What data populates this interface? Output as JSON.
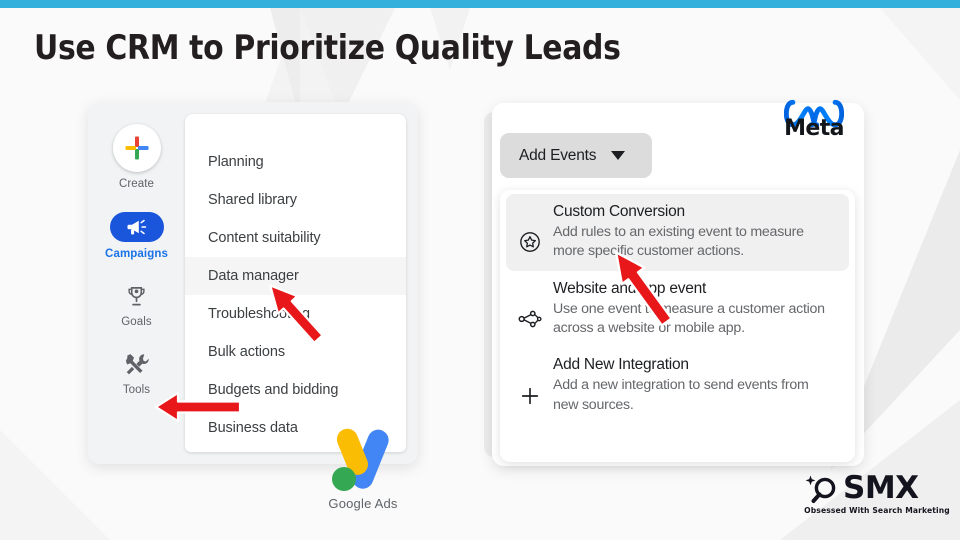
{
  "page": {
    "title": "Use CRM to Prioritize Quality Leads",
    "accent_bar_color": "#33b0db",
    "background_color": "#fafafa"
  },
  "google_ads_panel": {
    "logo_text": "Google Ads",
    "rail": [
      {
        "label": "Create",
        "icon": "plus-icon",
        "active": false
      },
      {
        "label": "Campaigns",
        "icon": "megaphone-icon",
        "active": true
      },
      {
        "label": "Goals",
        "icon": "trophy-icon",
        "active": false
      },
      {
        "label": "Tools",
        "icon": "tools-icon",
        "active": false
      }
    ],
    "menu_items": [
      {
        "label": "Planning",
        "highlighted": false
      },
      {
        "label": "Shared library",
        "highlighted": false
      },
      {
        "label": "Content suitability",
        "highlighted": false
      },
      {
        "label": "Data manager",
        "highlighted": true
      },
      {
        "label": "Troubleshooting",
        "highlighted": false
      },
      {
        "label": "Bulk actions",
        "highlighted": false
      },
      {
        "label": "Budgets and bidding",
        "highlighted": false
      },
      {
        "label": "Business data",
        "highlighted": false
      }
    ],
    "active_accent_color": "#1a73e8"
  },
  "meta_panel": {
    "brand_name": "Meta",
    "brand_color": "#0081fb",
    "add_events_button": {
      "label": "Add Events",
      "caret_icon": "chevron-down-icon"
    },
    "dropdown_items": [
      {
        "title": "Custom Conversion",
        "description": "Add rules to an existing event to measure more specific customer actions.",
        "icon": "star-circle-icon",
        "selected": true
      },
      {
        "title": "Website and app event",
        "description": "Use one event to measure a customer action across a website or mobile app.",
        "icon": "connector-nodes-icon",
        "selected": false
      },
      {
        "title": "Add New Integration",
        "description": "Add a new integration to send events from new sources.",
        "icon": "plus-icon",
        "selected": false
      }
    ]
  },
  "smx_logo": {
    "wordmark": "SMX",
    "tagline": "Obsessed With Search Marketing",
    "icon": "magnifier-sparkle-icon"
  },
  "annotations": {
    "arrow_color": "#e8171a",
    "arrows": [
      {
        "name": "arrow-to-data-manager",
        "points_to": "Data manager"
      },
      {
        "name": "arrow-to-tools",
        "points_to": "Tools"
      },
      {
        "name": "arrow-to-custom-conversion",
        "points_to": "Custom Conversion"
      }
    ]
  }
}
